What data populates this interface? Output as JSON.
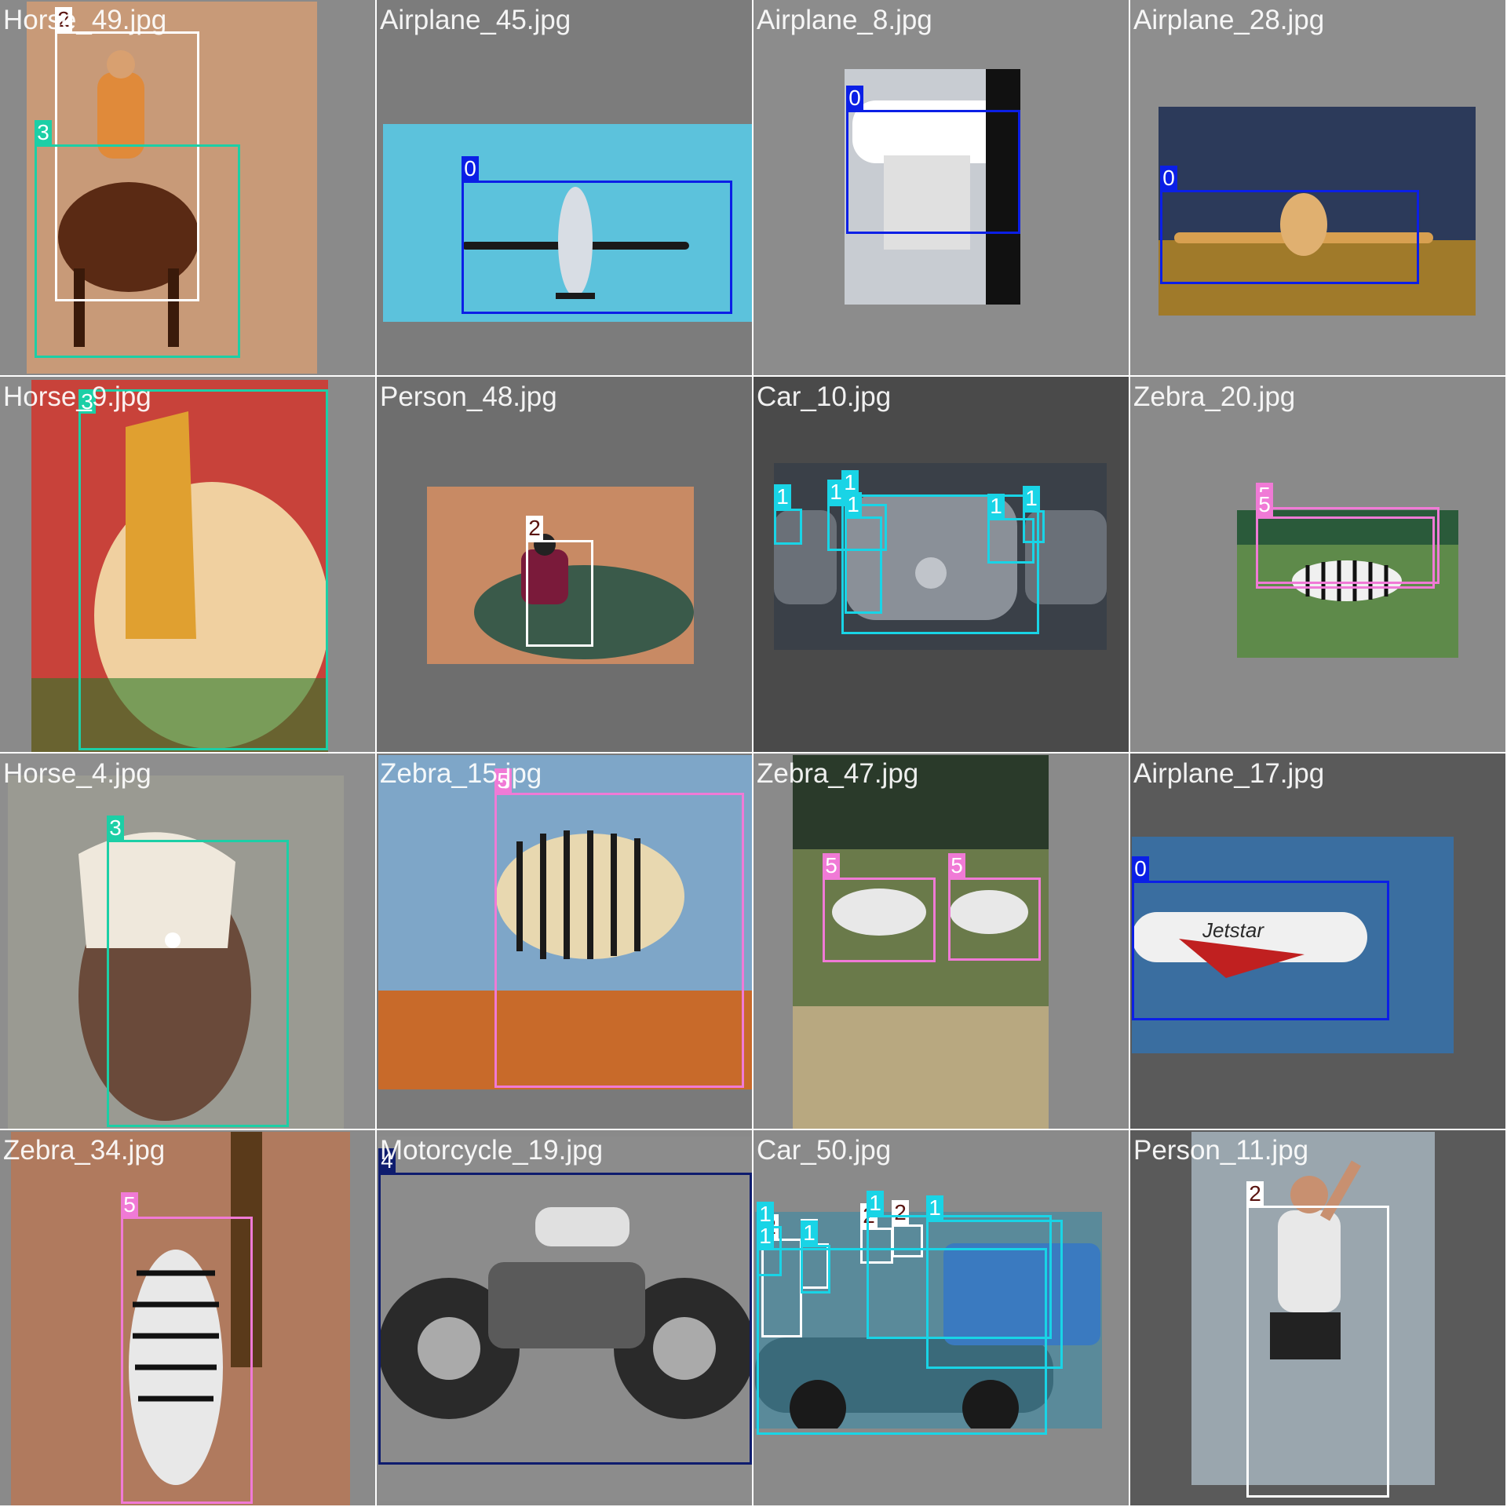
{
  "class_colors": {
    "0": {
      "box": "#0b1fe6",
      "label_bg": "#0b1fe6",
      "label_fg": "#ffffff"
    },
    "1": {
      "box": "#19d4e6",
      "label_bg": "#19d4e6",
      "label_fg": "#ffffff"
    },
    "2": {
      "box": "#ffffff",
      "label_bg": "#ffffff",
      "label_fg": "#5a1410"
    },
    "3": {
      "box": "#1ccfa6",
      "label_bg": "#1ccfa6",
      "label_fg": "#ffffff"
    },
    "4": {
      "box": "#0e1c6e",
      "label_bg": "#0e1c6e",
      "label_fg": "#ffffff"
    },
    "5": {
      "box": "#f07ad6",
      "label_bg": "#f07ad6",
      "label_fg": "#ffffff"
    }
  },
  "tiles": [
    {
      "filename": "Horse_49.jpg",
      "background": "#8a8a8a",
      "photo_color": "#c89a78",
      "photo_desc": "rider-on-horse",
      "detections": [
        "2",
        "3"
      ]
    },
    {
      "filename": "Airplane_45.jpg",
      "background": "#7c7c7c",
      "photo_color": "#5cc2dc",
      "photo_desc": "airplane-in-sky",
      "detections": [
        "0"
      ]
    },
    {
      "filename": "Airplane_8.jpg",
      "background": "#8c8c8c",
      "photo_color": "#c8ccd2",
      "photo_desc": "airplane-at-gate",
      "detections": [
        "0"
      ]
    },
    {
      "filename": "Airplane_28.jpg",
      "background": "#8e8e8e",
      "photo_color": "#2c3a5a",
      "photo_desc": "cargo-plane-dusk",
      "detections": [
        "0"
      ]
    },
    {
      "filename": "Horse_9.jpg",
      "background": "#8a8a8a",
      "photo_color": "#c8423a",
      "photo_desc": "decorated-horse",
      "detections": [
        "3"
      ]
    },
    {
      "filename": "Person_48.jpg",
      "background": "#6e6e6e",
      "photo_color": "#c88a64",
      "photo_desc": "person-at-canyon",
      "detections": [
        "2"
      ]
    },
    {
      "filename": "Car_10.jpg",
      "background": "#4a4a4a",
      "photo_color": "#3a4048",
      "photo_desc": "cars-front",
      "detections": [
        "1",
        "1",
        "1",
        "1",
        "1",
        "1"
      ]
    },
    {
      "filename": "Zebra_20.jpg",
      "background": "#8a8a8a",
      "photo_color": "#5e8a4a",
      "photo_desc": "zebra-on-grass",
      "detections": [
        "5",
        "5"
      ]
    },
    {
      "filename": "Horse_4.jpg",
      "background": "#8e8e8e",
      "photo_color": "#9a9a92",
      "photo_desc": "horse-portrait",
      "detections": [
        "3"
      ]
    },
    {
      "filename": "Zebra_15.jpg",
      "background": "#7a7a7a",
      "photo_color": "#7ea6c8",
      "photo_desc": "zebra-standing",
      "detections": [
        "5"
      ]
    },
    {
      "filename": "Zebra_47.jpg",
      "background": "#8a8a8a",
      "photo_color": "#6a7a4a",
      "photo_desc": "zebras-grazing",
      "detections": [
        "5",
        "5"
      ]
    },
    {
      "filename": "Airplane_17.jpg",
      "background": "#5a5a5a",
      "photo_color": "#3a6ea0",
      "photo_desc": "jetliner-landing",
      "detections": [
        "0"
      ]
    },
    {
      "filename": "Zebra_34.jpg",
      "background": "#8a8a8a",
      "photo_color": "#b07a5e",
      "photo_desc": "zebra-walking",
      "detections": [
        "5"
      ]
    },
    {
      "filename": "Motorcycle_19.jpg",
      "background": "#8a8a8a",
      "photo_color": "#8c8c8c",
      "photo_desc": "motorcycle-bw",
      "detections": [
        "4"
      ]
    },
    {
      "filename": "Car_50.jpg",
      "background": "#8a8a8a",
      "photo_color": "#5a8a9a",
      "photo_desc": "vintage-car",
      "detections": [
        "2",
        "2",
        "2",
        "2",
        "1",
        "1",
        "1",
        "1",
        "1"
      ]
    },
    {
      "filename": "Person_11.jpg",
      "background": "#5a5a5a",
      "photo_color": "#9aa6ae",
      "photo_desc": "person-jumping",
      "detections": [
        "2"
      ]
    }
  ]
}
